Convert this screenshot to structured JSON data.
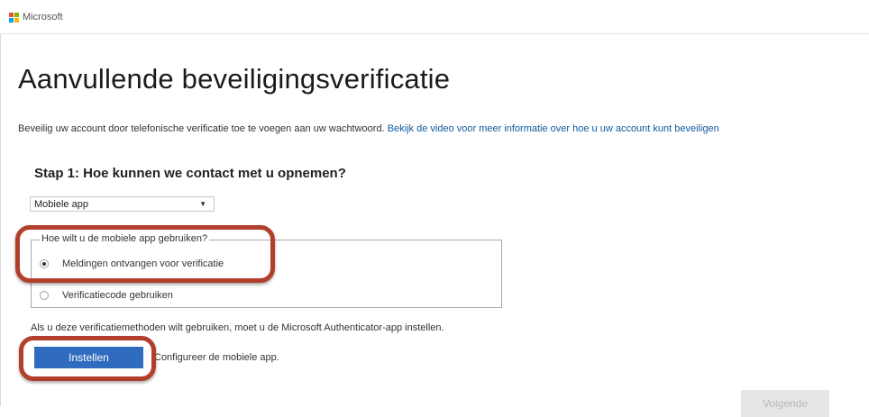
{
  "header": {
    "brand": "Microsoft",
    "logo_colors": [
      "#f25022",
      "#7fba00",
      "#00a4ef",
      "#ffb900"
    ]
  },
  "page": {
    "title": "Aanvullende beveiligingsverificatie",
    "description": "Beveilig uw account door telefonische verificatie toe te voegen aan uw wachtwoord.",
    "video_link": "Bekijk de video voor meer informatie over hoe u uw account kunt beveiligen"
  },
  "step1": {
    "heading": "Stap 1: Hoe kunnen we contact met u opnemen?",
    "method_select": {
      "value": "Mobiele app",
      "arrow_icon": "triangle-down-icon"
    },
    "usage_group": {
      "legend": "Hoe wilt u de mobiele app gebruiken?",
      "options": [
        {
          "label": "Meldingen ontvangen voor verificatie",
          "checked": true
        },
        {
          "label": "Verificatiecode gebruiken",
          "checked": false
        }
      ]
    },
    "info_text": "Als u deze verificatiemethoden wilt gebruiken, moet u de Microsoft Authenticator-app instellen.",
    "setup_button": "Instellen",
    "setup_hint": "Configureer de mobiele app."
  },
  "footer": {
    "next_button": "Volgende"
  },
  "highlight_color": "#b13f2c",
  "accent_color": "#2f6bbf",
  "link_color": "#0d5b9c"
}
